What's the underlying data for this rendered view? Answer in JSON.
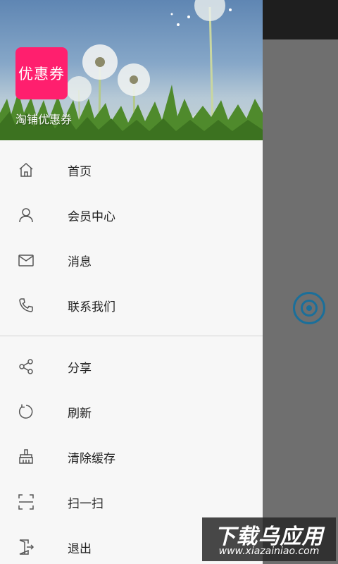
{
  "header": {
    "badge_text": "优惠券",
    "app_name": "淘铺优惠券",
    "badge_color": "#ff1f6e"
  },
  "menu_primary": [
    {
      "icon": "home-icon",
      "label": "首页"
    },
    {
      "icon": "user-icon",
      "label": "会员中心"
    },
    {
      "icon": "mail-icon",
      "label": "消息"
    },
    {
      "icon": "phone-icon",
      "label": "联系我们"
    }
  ],
  "menu_secondary": [
    {
      "icon": "share-icon",
      "label": "分享"
    },
    {
      "icon": "refresh-icon",
      "label": "刷新"
    },
    {
      "icon": "broom-icon",
      "label": "清除缓存"
    },
    {
      "icon": "scan-icon",
      "label": "扫一扫"
    },
    {
      "icon": "exit-icon",
      "label": "退出"
    }
  ],
  "watermark": {
    "title": "下载乌应用",
    "url": "www.xiazainiao.com"
  },
  "colors": {
    "scrim": "#6f6f6f",
    "fab": "#1b6f9a",
    "drawer_bg": "#f7f7f7"
  }
}
